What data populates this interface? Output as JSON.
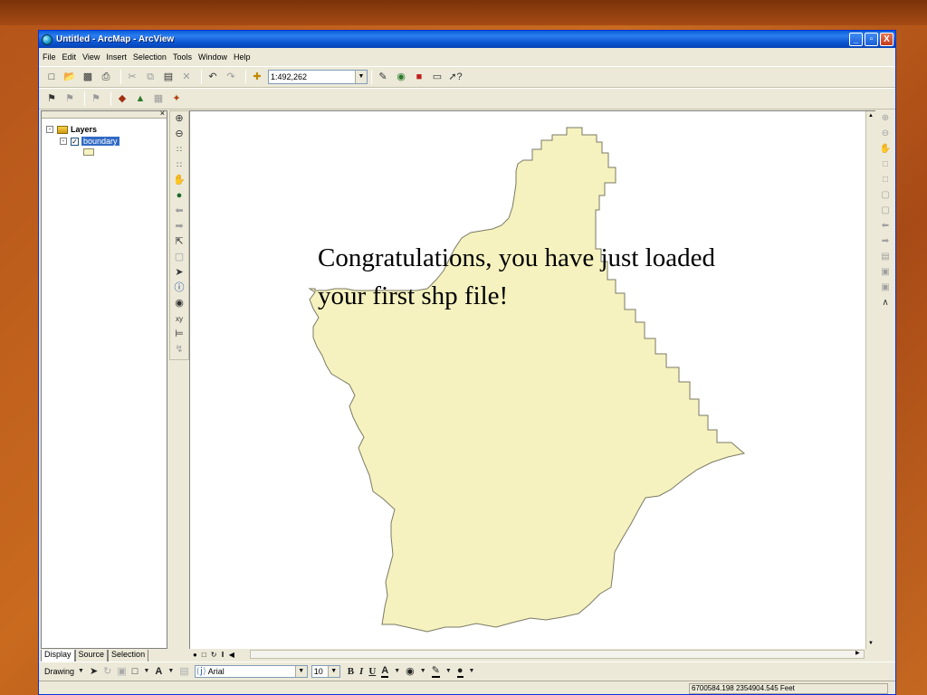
{
  "window": {
    "title": "Untitled - ArcMap - ArcView",
    "controls": [
      "_",
      "▫",
      "X"
    ]
  },
  "menu": [
    "File",
    "Edit",
    "View",
    "Insert",
    "Selection",
    "Tools",
    "Window",
    "Help"
  ],
  "toolbar": {
    "scale_value": "1:492,262"
  },
  "toc": {
    "root_label": "Layers",
    "layer_label": "boundary",
    "tabs": [
      "Display",
      "Source",
      "Selection"
    ]
  },
  "drawing": {
    "drawing_label": "Drawing",
    "font_value": "Arial",
    "size_value": "10",
    "bold": "B",
    "italic": "I",
    "underline": "U",
    "text_tool": "A"
  },
  "status": {
    "coordinates": "6700584.198  2354904.545 Feet"
  },
  "annotation": {
    "line1": "Congratulations, you have just loaded",
    "line2": "your first shp file!"
  },
  "colors": {
    "polygon_fill": "#f5f2bf",
    "polygon_outline": "#7b7a66",
    "title_bar": "#0a5fd8",
    "selection": "#316ac5"
  },
  "icons": {
    "toolbar_main": [
      "new-icon",
      "open-icon",
      "save-icon",
      "print-icon",
      "cut-icon",
      "copy-icon",
      "paste-icon",
      "delete-icon",
      "undo-icon",
      "redo-icon",
      "add-data-icon",
      "editor-icon",
      "arccatalog-icon",
      "arctoolbox-icon",
      "command-line-icon",
      "whats-this-icon"
    ],
    "tools_vertical": [
      "zoom-in-icon",
      "zoom-out-icon",
      "fixed-zoom-in-icon",
      "fixed-zoom-out-icon",
      "pan-icon",
      "full-extent-icon",
      "back-icon",
      "forward-icon",
      "select-features-icon",
      "clear-selection-icon",
      "select-elements-icon",
      "identify-icon",
      "find-icon",
      "go-to-xy-icon",
      "measure-icon",
      "hyperlink-icon"
    ]
  }
}
